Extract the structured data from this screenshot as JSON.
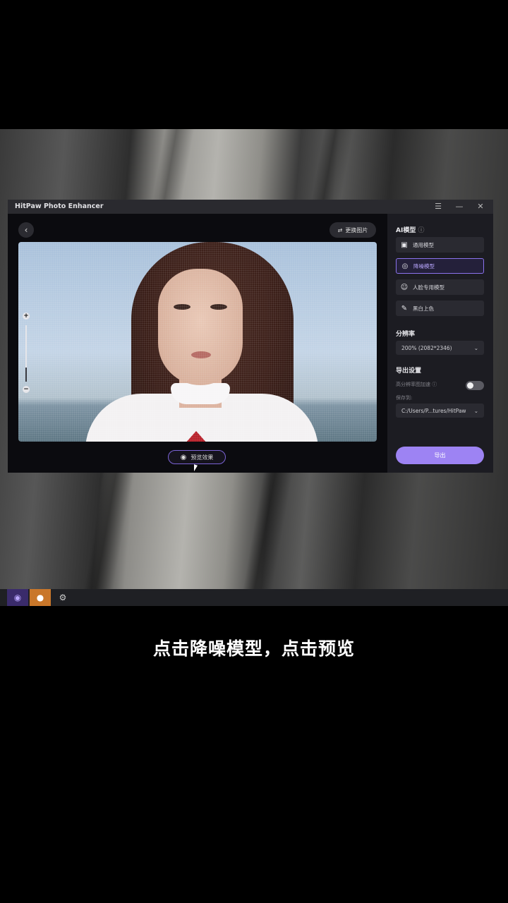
{
  "caption": "点击降噪模型，点击预览",
  "window": {
    "title": "HitPaw Photo Enhancer",
    "menu_icon": "menu-icon",
    "minimize_icon": "minimize-icon",
    "close_icon": "close-icon"
  },
  "toolbar": {
    "back_icon": "back-icon",
    "replace_label": "更换图片",
    "replace_icon": "swap-icon"
  },
  "preview": {
    "button_label": "预览效果",
    "button_icon": "eye-icon"
  },
  "panel": {
    "ai_model_title": "AI模型",
    "models": [
      {
        "label": "通用模型",
        "icon": "image-icon",
        "active": false
      },
      {
        "label": "降噪模型",
        "icon": "denoise-icon",
        "active": true
      },
      {
        "label": "人脸专用模型",
        "icon": "face-icon",
        "active": false
      },
      {
        "label": "黑白上色",
        "icon": "brush-icon",
        "active": false
      }
    ],
    "resolution_title": "分辨率",
    "resolution_value": "200% (2082*2346)",
    "export_settings_title": "导出设置",
    "hires_accel_label": "高分辨率图加速",
    "hires_accel_on": false,
    "save_to_label": "保存到:",
    "save_path": "C:/Users/P...tures/HitPaw",
    "export_label": "导出"
  },
  "colors": {
    "accent": "#9d83f3",
    "active_border": "#8b73ee",
    "panel_bg": "#1c1c22"
  }
}
